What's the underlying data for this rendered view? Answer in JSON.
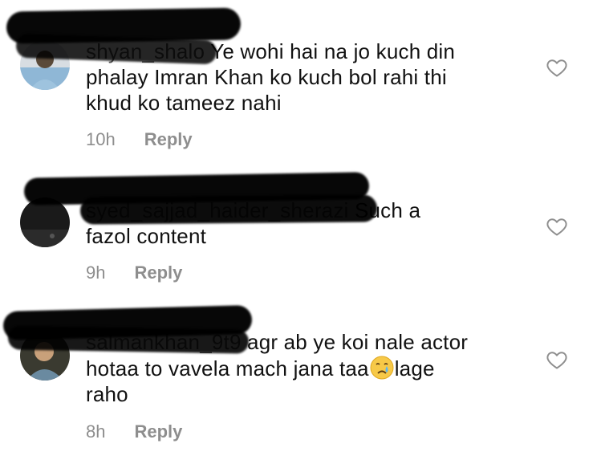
{
  "comments": [
    {
      "username": "shyan_shalo",
      "text": "Ye wohi hai na jo kuch din phalay Imran Khan ko kuch bol rahi thi khud ko tameez nahi",
      "lines": [
        "Ye wohi hai na jo kuch din",
        "phalay Imran Khan ko kuch bol rahi thi",
        "khud ko tameez nahi"
      ],
      "time": "10h",
      "reply": "Reply"
    },
    {
      "username": "syed_sajjad_haider_sherazi",
      "text": "Such a fazol content",
      "lines": [
        "Such a",
        "fazol content"
      ],
      "time": "9h",
      "reply": "Reply"
    },
    {
      "username": "salmankhan_9t9",
      "text": "agr ab ye koi nale actor hotaa to vavela mach jana taa lage raho",
      "lines": [
        "agr ab ye koi nale actor",
        "hotaa to vavela mach jana taa",
        "lage",
        "raho"
      ],
      "emoji": "crying-face-emoji",
      "time": "8h",
      "reply": "Reply"
    }
  ],
  "icons": {
    "like": "heart-outline-icon"
  },
  "colors": {
    "text": "#111111",
    "meta": "#8e8e8e",
    "redaction": "#000000"
  }
}
